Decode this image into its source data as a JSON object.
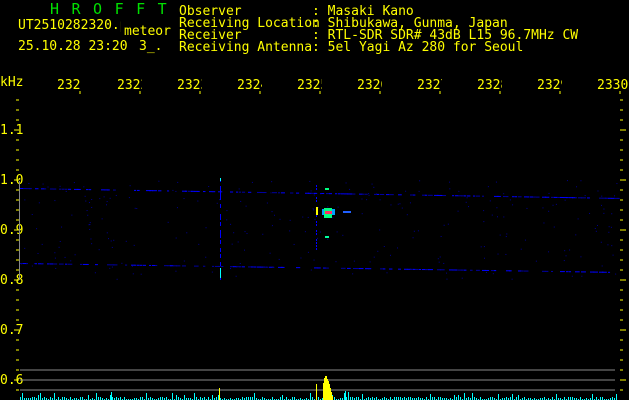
{
  "app": {
    "title": "HROFFT"
  },
  "file": {
    "name": "UT2510282320.png",
    "mode": "meteor",
    "datetime": "25.10.28 23:20",
    "count": "3_."
  },
  "info": [
    {
      "label": "Observer",
      "value": "Masaki Kano"
    },
    {
      "label": "Receiving Location",
      "value": "Shibukawa, Gunma, Japan"
    },
    {
      "label": "Receiver",
      "value": "RTL-SDR SDR# 43dB L15 96.7MHz CW"
    },
    {
      "label": "Receiving Antenna",
      "value": "5el Yagi Az 280 for Seoul"
    }
  ],
  "axis": {
    "y_unit": "kHz",
    "y_ticks": [
      "1.1",
      "1.0",
      "0.9",
      "0.8",
      "0.7",
      "0.6"
    ],
    "x_ticks": [
      "2321",
      "2322",
      "2323",
      "2324",
      "2325",
      "2326",
      "2327",
      "2328",
      "2329",
      "2330"
    ]
  },
  "colors": {
    "text": "#ffff00",
    "title": "#00e000",
    "signal": "#0000ff",
    "echo": "#ff3060",
    "histogram": "#00ffff",
    "histogram_peak": "#ffff00"
  }
}
